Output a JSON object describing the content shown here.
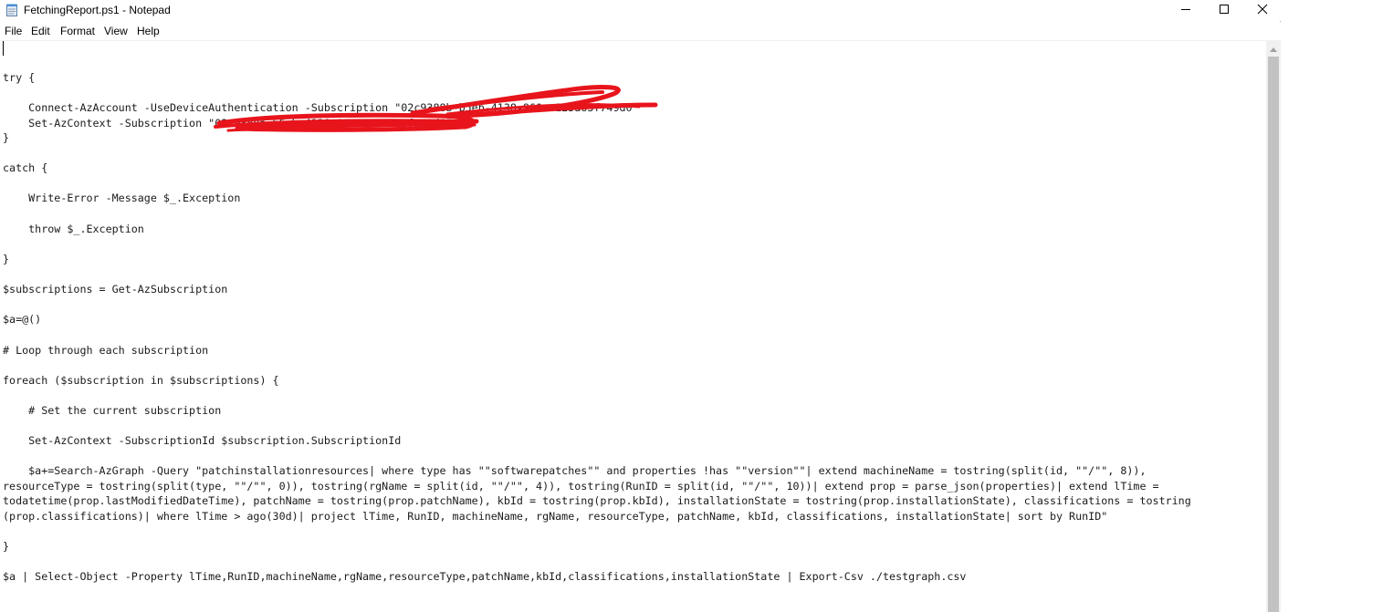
{
  "window": {
    "title": "FetchingReport.ps1 - Notepad"
  },
  "menu": {
    "items": [
      "File",
      "Edit",
      "Format",
      "View",
      "Help"
    ]
  },
  "editor": {
    "lines": [
      "try {",
      "    Connect-AzAccount -UseDeviceAuthentication -Subscription \"02c9388b-b5eb-4138-960a-125a63f749d0\"",
      "    Set-AzContext -Subscription \"02c9388b-b5eb-4138-960a-125a63f749d0\"",
      "}",
      "catch {",
      "    Write-Error -Message $_.Exception",
      "    throw $_.Exception",
      "}",
      "$subscriptions = Get-AzSubscription",
      "$a=@()",
      "# Loop through each subscription",
      "foreach ($subscription in $subscriptions) {",
      "    # Set the current subscription",
      "    Set-AzContext -SubscriptionId $subscription.SubscriptionId",
      "    $a+=Search-AzGraph -Query \"patchinstallationresources| where type has \"\"softwarepatches\"\" and properties !has \"\"version\"\"| extend machineName = tostring(split(id, \"\"/\"\", 8)),",
      "resourceType = tostring(split(type, \"\"/\"\", 0)), tostring(rgName = split(id, \"\"/\"\", 4)), tostring(RunID = split(id, \"\"/\"\", 10))| extend prop = parse_json(properties)| extend lTime =",
      "todatetime(prop.lastModifiedDateTime), patchName = tostring(prop.patchName), kbId = tostring(prop.kbId), installationState = tostring(prop.installationState), classifications = tostring",
      "(prop.classifications)| where lTime > ago(30d)| project lTime, RunID, machineName, rgName, resourceType, patchName, kbId, classifications, installationState| sort by RunID\"",
      "}",
      "$a | Select-Object -Property lTime,RunID,machineName,rgName,resourceType,patchName,kbId,classifications,installationState | Export-Csv ./testgraph.csv"
    ]
  },
  "icons": {
    "app": "notepad-icon",
    "minimize": "minimize-icon",
    "maximize": "maximize-icon",
    "close": "close-icon",
    "scroll_up": "scroll-up-arrow-icon"
  },
  "colors": {
    "redaction": "#e8141c"
  }
}
